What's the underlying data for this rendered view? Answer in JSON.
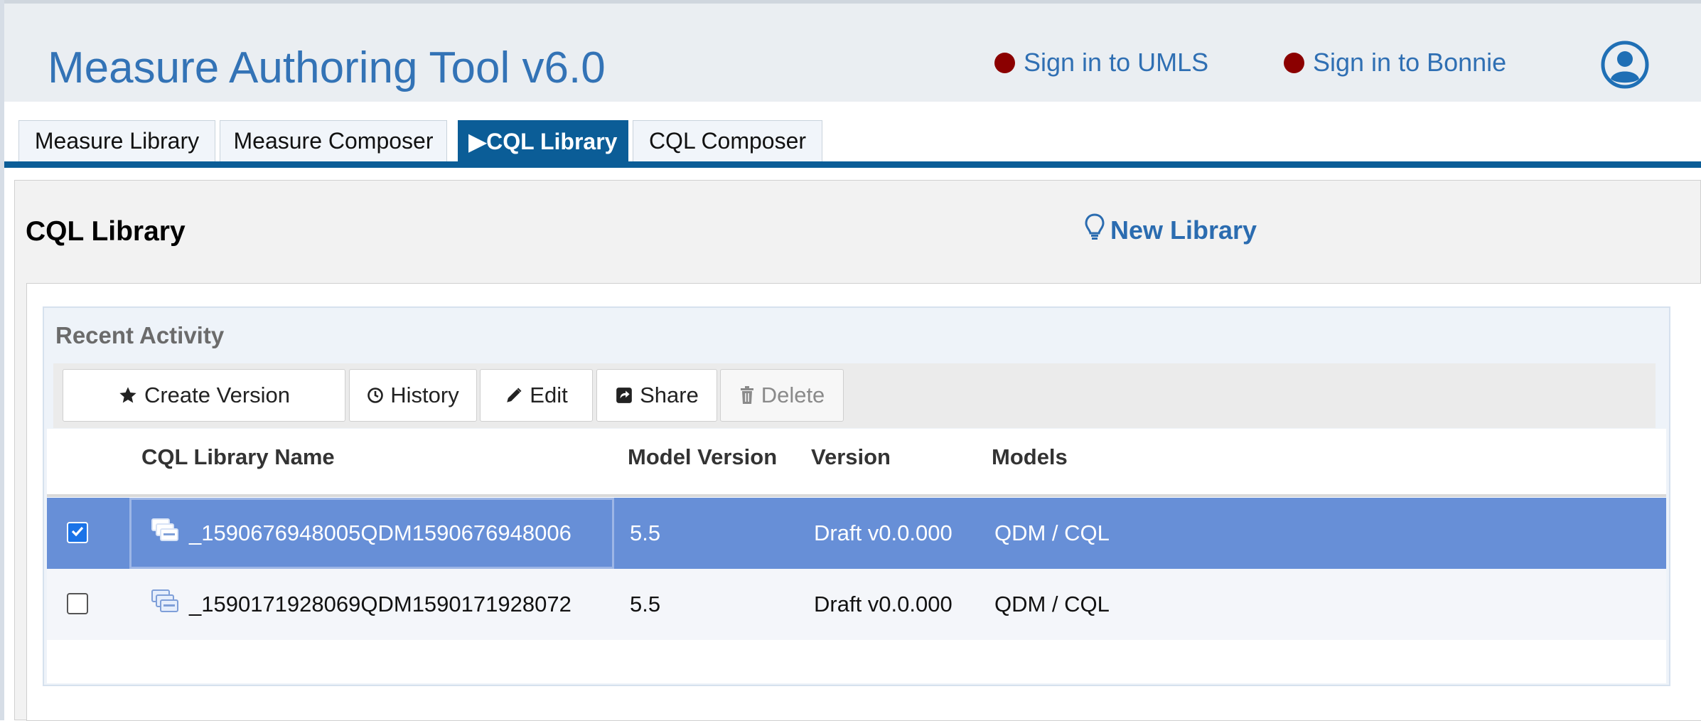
{
  "header": {
    "app_title": "Measure Authoring Tool v6.0",
    "signin_umls": "Sign in to UMLS",
    "signin_bonnie": "Sign in to Bonnie",
    "status_dot_color": "#8b0000"
  },
  "tabs": [
    {
      "label": "Measure Library",
      "active": false
    },
    {
      "label": "Measure Composer",
      "active": false
    },
    {
      "label": "▶CQL Library",
      "active": true
    },
    {
      "label": "CQL Composer",
      "active": false
    }
  ],
  "page": {
    "heading": "CQL Library",
    "new_library_label": "New Library"
  },
  "recent": {
    "title": "Recent Activity",
    "toolbar": {
      "create_version": "Create Version",
      "history": "History",
      "edit": "Edit",
      "share": "Share",
      "delete": "Delete"
    },
    "columns": [
      "CQL Library Name",
      "Model Version",
      "Version",
      "Models"
    ],
    "rows": [
      {
        "selected": true,
        "name": "_1590676948005QDM1590676948006",
        "model_version": "5.5",
        "version": "Draft v0.0.000",
        "models": "QDM / CQL"
      },
      {
        "selected": false,
        "name": "_1590171928069QDM1590171928072",
        "model_version": "5.5",
        "version": "Draft v0.0.000",
        "models": "QDM / CQL"
      }
    ]
  },
  "colors": {
    "brand_blue": "#0b5d97",
    "selected_row": "#678fd7",
    "link_blue": "#2b6cb0"
  },
  "icons": [
    "user-circle-icon",
    "lightbulb-icon",
    "star-icon",
    "clock-icon",
    "pencil-icon",
    "share-icon",
    "trash-icon",
    "library-stack-icon",
    "checkbox-checked-icon"
  ]
}
